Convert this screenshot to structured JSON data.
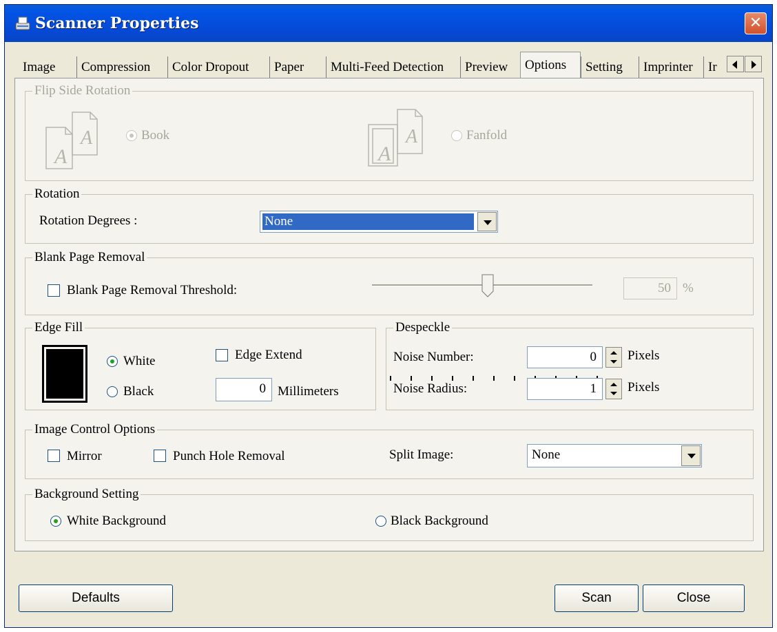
{
  "window": {
    "title": "Scanner Properties"
  },
  "tabs": [
    "Image",
    "Compression",
    "Color Dropout",
    "Paper",
    "Multi-Feed Detection",
    "Preview",
    "Options",
    "Setting",
    "Imprinter",
    "Ir"
  ],
  "active_tab": "Options",
  "flip_side": {
    "label": "Flip Side Rotation",
    "book": "Book",
    "fanfold": "Fanfold",
    "selected": "Book"
  },
  "rotation": {
    "label": "Rotation",
    "degrees_label": "Rotation Degrees :",
    "value": "None"
  },
  "blank_page": {
    "label": "Blank Page Removal",
    "threshold_label": "Blank Page Removal Threshold:",
    "value": "50",
    "unit": "%"
  },
  "edge_fill": {
    "label": "Edge Fill",
    "white": "White",
    "black": "Black",
    "extend": "Edge Extend",
    "value": "0",
    "unit": "Millimeters",
    "selected": "White",
    "swatch_color": "#000000"
  },
  "despeckle": {
    "label": "Despeckle",
    "noise_number_label": "Noise Number:",
    "noise_number_value": "0",
    "noise_radius_label": "Noise Radius:",
    "noise_radius_value": "1",
    "unit": "Pixels"
  },
  "image_control": {
    "label": "Image Control Options",
    "mirror": "Mirror",
    "punch": "Punch Hole Removal",
    "split_label": "Split Image:",
    "split_value": "None"
  },
  "background": {
    "label": "Background Setting",
    "white": "White Background",
    "black": "Black Background",
    "selected": "White Background"
  },
  "buttons": {
    "defaults": "Defaults",
    "scan": "Scan",
    "close": "Close"
  }
}
